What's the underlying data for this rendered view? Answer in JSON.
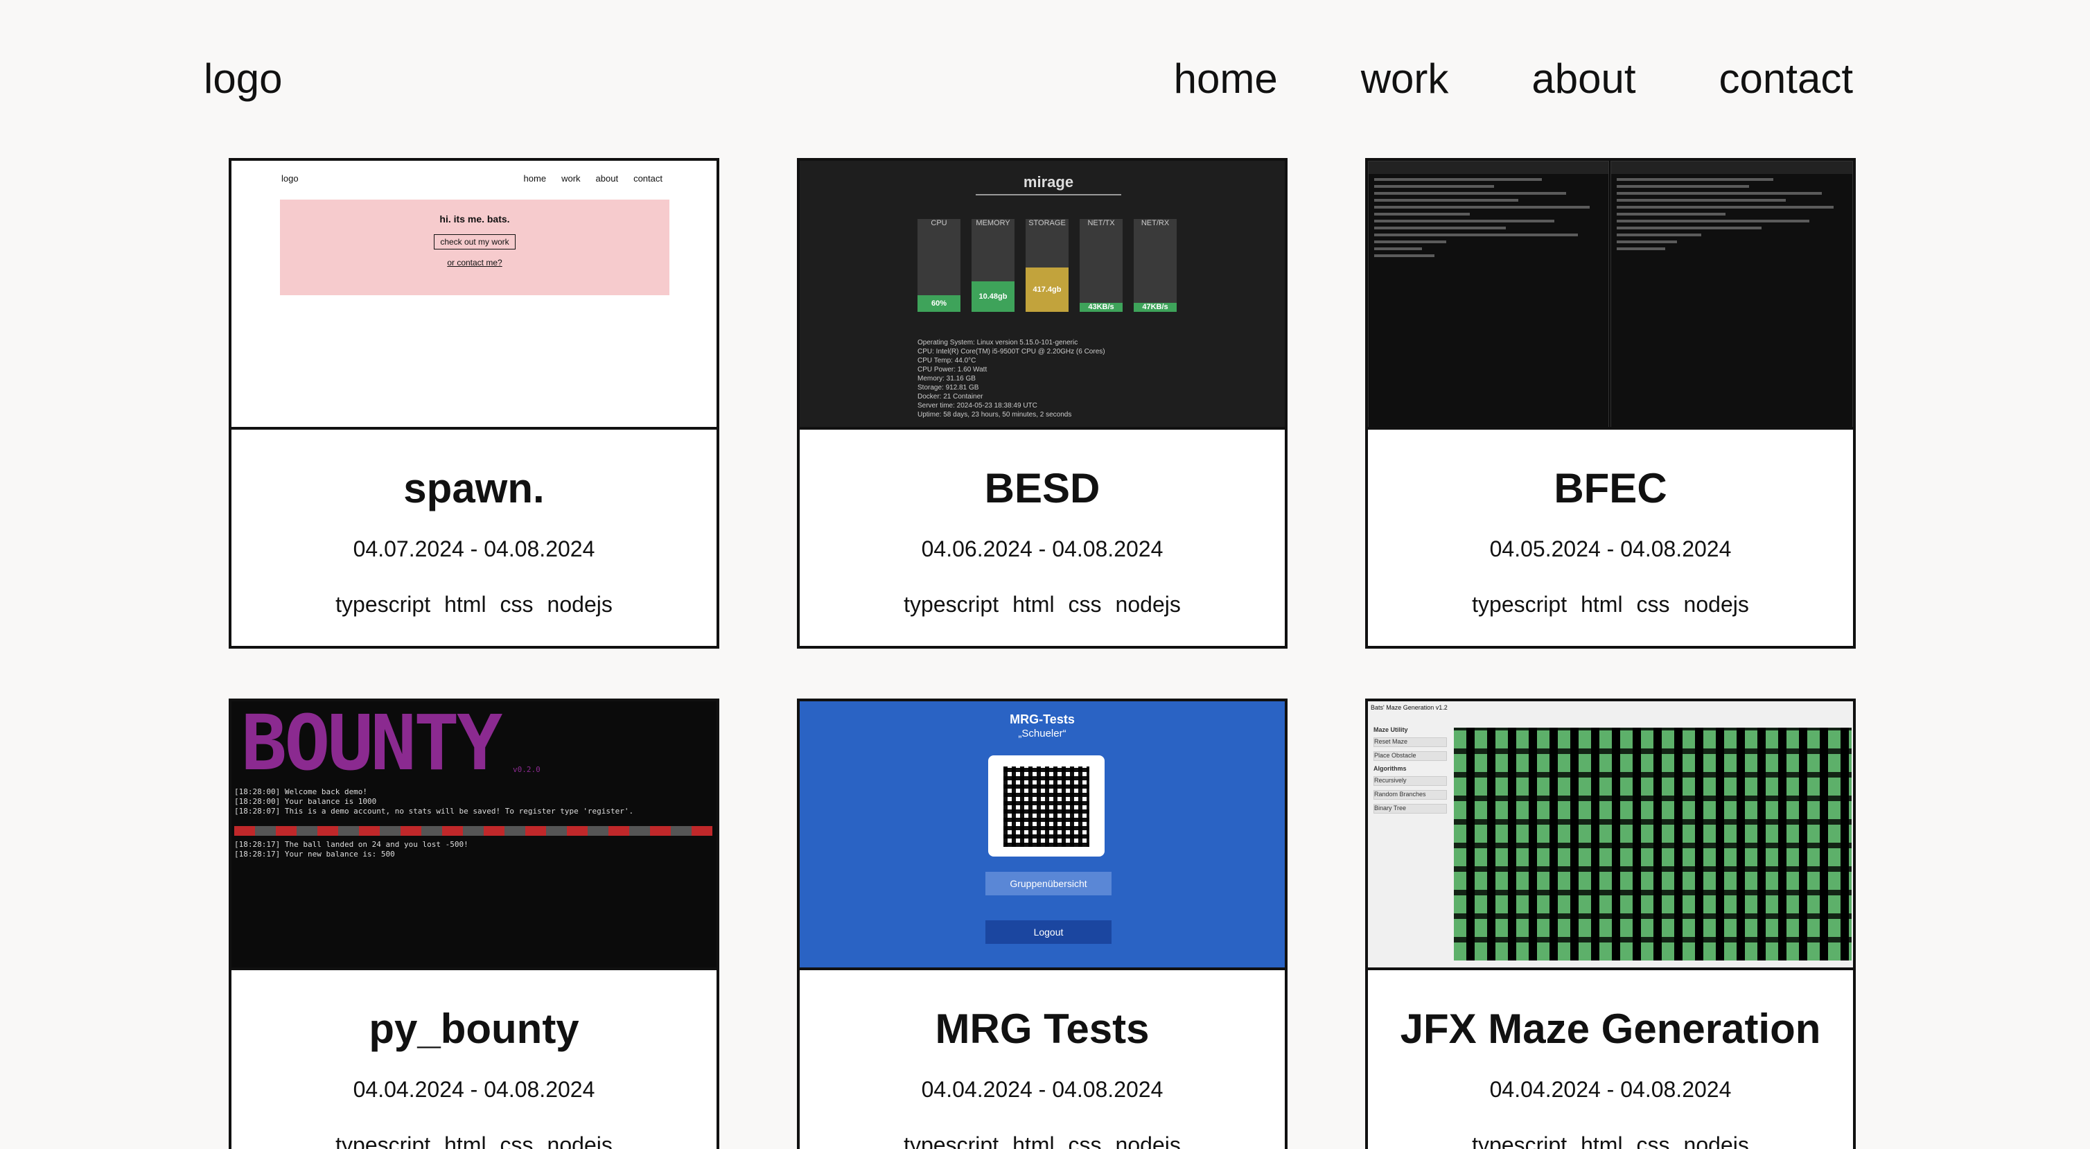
{
  "nav": {
    "logo": "logo",
    "links": [
      "home",
      "work",
      "about",
      "contact"
    ]
  },
  "cards": [
    {
      "title": "spawn.",
      "date": "04.07.2024 - 04.08.2024",
      "tags": [
        "typescript",
        "html",
        "css",
        "nodejs"
      ],
      "preview": {
        "logo": "logo",
        "nav": [
          "home",
          "work",
          "about",
          "contact"
        ],
        "heading": "hi. its me. bats.",
        "button": "check out my work",
        "link": "or contact me?"
      }
    },
    {
      "title": "BESD",
      "date": "04.06.2024 - 04.08.2024",
      "tags": [
        "typescript",
        "html",
        "css",
        "nodejs"
      ],
      "preview": {
        "header": "mirage",
        "bars": [
          {
            "label": "CPU",
            "value": "60%",
            "fill": 0.18,
            "color": "#3ea35a"
          },
          {
            "label": "MEMORY",
            "value": "10.48gb",
            "fill": 0.33,
            "color": "#3ea35a"
          },
          {
            "label": "STORAGE",
            "value": "417.4gb",
            "fill": 0.48,
            "color": "#c2a33c"
          },
          {
            "label": "NET/TX",
            "value": "43KB/s",
            "fill": 0.1,
            "color": "#3ea35a"
          },
          {
            "label": "NET/RX",
            "value": "47KB/s",
            "fill": 0.1,
            "color": "#3ea35a"
          }
        ],
        "info": [
          "Operating System: Linux version 5.15.0-101-generic",
          "CPU: Intel(R) Core(TM) i5-9500T CPU @ 2.20GHz (6 Cores)",
          "CPU Temp: 44.0°C",
          "CPU Power: 1.60 Watt",
          "Memory: 31.16 GB",
          "Storage: 912.81 GB",
          "Docker: 21 Container",
          "Server time: 2024-05-23 18:38:49 UTC",
          "Uptime: 58 days, 23 hours, 50 minutes, 2 seconds"
        ]
      }
    },
    {
      "title": "BFEC",
      "date": "04.05.2024 - 04.08.2024",
      "tags": [
        "typescript",
        "html",
        "css",
        "nodejs"
      ]
    },
    {
      "title": "py_bounty",
      "date": "04.04.2024 - 04.08.2024",
      "tags": [
        "typescript",
        "html",
        "css",
        "nodejs"
      ],
      "preview": {
        "logo": "BOUNTY",
        "version": "v0.2.0",
        "lines": [
          "[18:28:00] Welcome back demo!",
          "[18:28:00] Your balance is 1000",
          "[18:28:07] This is a demo account, no stats will be saved! To register type 'register'."
        ],
        "lines2": [
          "[18:28:17] The ball landed on 24 and you lost -500!",
          "[18:28:17] Your new balance is: 500"
        ]
      }
    },
    {
      "title": "MRG Tests",
      "date": "04.04.2024 - 04.08.2024",
      "tags": [
        "typescript",
        "html",
        "css",
        "nodejs"
      ],
      "preview": {
        "heading": "MRG-Tests",
        "sub": "„Schueler“",
        "button1": "Gruppenübersicht",
        "button2": "Logout"
      }
    },
    {
      "title": "JFX Maze Generation",
      "date": "04.04.2024 - 04.08.2024",
      "tags": [
        "typescript",
        "html",
        "css",
        "nodejs"
      ],
      "preview": {
        "window_title": "Bats' Maze Generation v1.2",
        "sections": [
          "Maze Utility",
          "Reset Maze",
          "Place Obstacle",
          "Algorithms",
          "Recursively",
          "Random Branches",
          "Binary Tree"
        ]
      }
    }
  ]
}
